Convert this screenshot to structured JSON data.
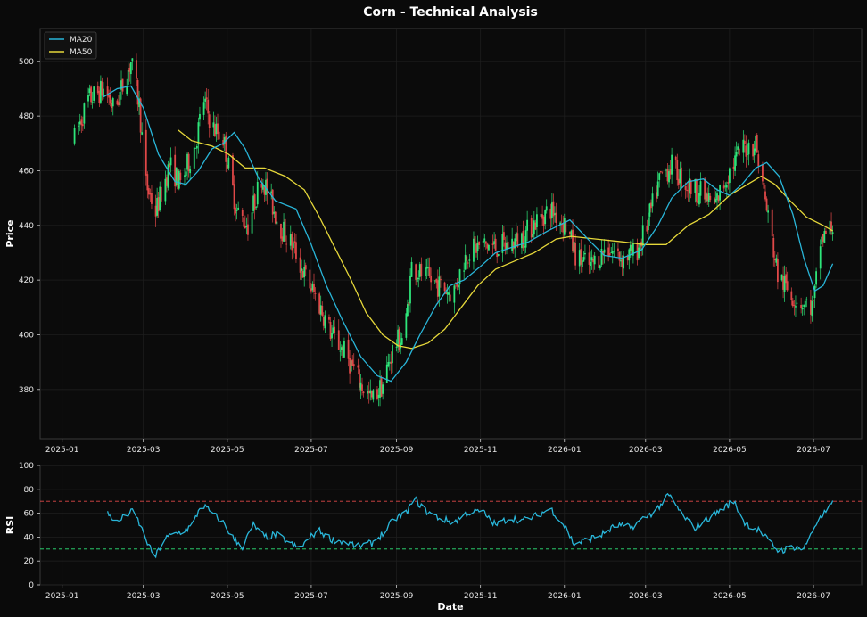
{
  "chart_data": [
    {
      "type": "candlestick",
      "title": "Corn - Technical Analysis",
      "ylabel": "Price",
      "ylim": [
        362,
        512
      ],
      "yticks": [
        380,
        400,
        420,
        440,
        460,
        480,
        500
      ],
      "xlim": [
        "2024-12-16",
        "2026-08-05"
      ],
      "xticks": [
        "2025-01",
        "2025-03",
        "2025-05",
        "2025-07",
        "2025-09",
        "2025-11",
        "2026-01",
        "2026-03",
        "2026-05",
        "2026-07"
      ],
      "grid": true,
      "legend": {
        "position": "top-left",
        "entries": [
          {
            "name": "MA20",
            "color": "#29b6d9"
          },
          {
            "name": "MA50",
            "color": "#e6d83a"
          }
        ]
      },
      "colors": {
        "up": "#2ee67a",
        "down": "#e04848"
      },
      "price_anchors": [
        [
          "2025-01-10",
          472
        ],
        [
          "2025-01-20",
          486
        ],
        [
          "2025-02-01",
          490
        ],
        [
          "2025-02-08",
          482
        ],
        [
          "2025-02-20",
          500
        ],
        [
          "2025-02-26",
          484
        ],
        [
          "2025-03-03",
          455
        ],
        [
          "2025-03-10",
          445
        ],
        [
          "2025-03-20",
          462
        ],
        [
          "2025-03-28",
          455
        ],
        [
          "2025-04-08",
          470
        ],
        [
          "2025-04-14",
          486
        ],
        [
          "2025-04-20",
          476
        ],
        [
          "2025-04-28",
          472
        ],
        [
          "2025-05-08",
          445
        ],
        [
          "2025-05-16",
          440
        ],
        [
          "2025-05-26",
          458
        ],
        [
          "2025-06-08",
          440
        ],
        [
          "2025-06-18",
          432
        ],
        [
          "2025-06-26",
          422
        ],
        [
          "2025-07-06",
          412
        ],
        [
          "2025-07-16",
          400
        ],
        [
          "2025-07-26",
          393
        ],
        [
          "2025-08-06",
          382
        ],
        [
          "2025-08-14",
          376
        ],
        [
          "2025-08-22",
          382
        ],
        [
          "2025-08-30",
          396
        ],
        [
          "2025-09-07",
          400
        ],
        [
          "2025-09-12",
          425
        ],
        [
          "2025-09-22",
          421
        ],
        [
          "2025-10-02",
          418
        ],
        [
          "2025-10-12",
          415
        ],
        [
          "2025-10-22",
          430
        ],
        [
          "2025-11-02",
          433
        ],
        [
          "2025-11-12",
          432
        ],
        [
          "2025-11-22",
          433
        ],
        [
          "2025-12-02",
          436
        ],
        [
          "2025-12-12",
          442
        ],
        [
          "2025-12-22",
          446
        ],
        [
          "2026-01-02",
          440
        ],
        [
          "2026-01-10",
          428
        ],
        [
          "2026-01-20",
          425
        ],
        [
          "2026-02-01",
          432
        ],
        [
          "2026-02-12",
          428
        ],
        [
          "2026-02-22",
          430
        ],
        [
          "2026-03-02",
          440
        ],
        [
          "2026-03-12",
          458
        ],
        [
          "2026-03-20",
          462
        ],
        [
          "2026-03-30",
          455
        ],
        [
          "2026-04-10",
          452
        ],
        [
          "2026-04-20",
          447
        ],
        [
          "2026-05-01",
          460
        ],
        [
          "2026-05-10",
          468
        ],
        [
          "2026-05-20",
          470
        ],
        [
          "2026-05-28",
          446
        ],
        [
          "2026-06-05",
          422
        ],
        [
          "2026-06-14",
          415
        ],
        [
          "2026-06-22",
          412
        ],
        [
          "2026-07-01",
          410
        ],
        [
          "2026-07-06",
          434
        ],
        [
          "2026-07-15",
          440
        ]
      ],
      "ma20": [
        [
          "2025-01-31",
          487
        ],
        [
          "2025-02-10",
          490
        ],
        [
          "2025-02-20",
          491
        ],
        [
          "2025-03-01",
          483
        ],
        [
          "2025-03-12",
          466
        ],
        [
          "2025-03-24",
          456
        ],
        [
          "2025-04-01",
          455
        ],
        [
          "2025-04-10",
          460
        ],
        [
          "2025-04-20",
          468
        ],
        [
          "2025-04-28",
          470
        ],
        [
          "2025-05-06",
          474
        ],
        [
          "2025-05-14",
          468
        ],
        [
          "2025-05-24",
          457
        ],
        [
          "2025-06-05",
          449
        ],
        [
          "2025-06-20",
          446
        ],
        [
          "2025-07-01",
          433
        ],
        [
          "2025-07-12",
          418
        ],
        [
          "2025-07-24",
          405
        ],
        [
          "2025-08-06",
          392
        ],
        [
          "2025-08-18",
          385
        ],
        [
          "2025-08-28",
          383
        ],
        [
          "2025-09-08",
          390
        ],
        [
          "2025-09-18",
          400
        ],
        [
          "2025-09-30",
          411
        ],
        [
          "2025-10-10",
          418
        ],
        [
          "2025-10-20",
          420
        ],
        [
          "2025-11-01",
          425
        ],
        [
          "2025-11-12",
          430
        ],
        [
          "2025-11-24",
          432
        ],
        [
          "2025-12-06",
          434
        ],
        [
          "2025-12-20",
          438
        ],
        [
          "2026-01-05",
          442
        ],
        [
          "2026-01-18",
          435
        ],
        [
          "2026-01-30",
          429
        ],
        [
          "2026-02-12",
          428
        ],
        [
          "2026-02-26",
          431
        ],
        [
          "2026-03-10",
          440
        ],
        [
          "2026-03-20",
          450
        ],
        [
          "2026-04-01",
          456
        ],
        [
          "2026-04-12",
          457
        ],
        [
          "2026-04-22",
          453
        ],
        [
          "2026-05-01",
          451
        ],
        [
          "2026-05-10",
          455
        ],
        [
          "2026-05-20",
          461
        ],
        [
          "2026-05-28",
          463
        ],
        [
          "2026-06-06",
          458
        ],
        [
          "2026-06-16",
          444
        ],
        [
          "2026-06-24",
          428
        ],
        [
          "2026-07-02",
          416
        ],
        [
          "2026-07-08",
          418
        ],
        [
          "2026-07-15",
          426
        ]
      ],
      "ma50": [
        [
          "2025-03-26",
          475
        ],
        [
          "2025-04-05",
          471
        ],
        [
          "2025-04-20",
          469
        ],
        [
          "2025-05-02",
          466
        ],
        [
          "2025-05-14",
          461
        ],
        [
          "2025-05-28",
          461
        ],
        [
          "2025-06-12",
          458
        ],
        [
          "2025-06-26",
          453
        ],
        [
          "2025-07-06",
          444
        ],
        [
          "2025-07-18",
          432
        ],
        [
          "2025-07-30",
          420
        ],
        [
          "2025-08-10",
          408
        ],
        [
          "2025-08-22",
          400
        ],
        [
          "2025-09-02",
          396
        ],
        [
          "2025-09-12",
          395
        ],
        [
          "2025-09-24",
          397
        ],
        [
          "2025-10-06",
          402
        ],
        [
          "2025-10-18",
          410
        ],
        [
          "2025-10-30",
          418
        ],
        [
          "2025-11-12",
          424
        ],
        [
          "2025-11-26",
          427
        ],
        [
          "2025-12-10",
          430
        ],
        [
          "2025-12-26",
          435
        ],
        [
          "2026-01-06",
          436
        ],
        [
          "2026-01-24",
          435
        ],
        [
          "2026-02-12",
          434
        ],
        [
          "2026-02-28",
          433
        ],
        [
          "2026-03-16",
          433
        ],
        [
          "2026-04-01",
          440
        ],
        [
          "2026-04-16",
          444
        ],
        [
          "2026-05-01",
          451
        ],
        [
          "2026-05-14",
          455
        ],
        [
          "2026-05-24",
          458
        ],
        [
          "2026-06-03",
          455
        ],
        [
          "2026-06-14",
          449
        ],
        [
          "2026-06-26",
          443
        ],
        [
          "2026-07-08",
          440
        ],
        [
          "2026-07-15",
          438
        ]
      ]
    },
    {
      "type": "line",
      "xlabel": "Date",
      "ylabel": "RSI",
      "ylim": [
        0,
        100
      ],
      "yticks": [
        0,
        20,
        40,
        60,
        80,
        100
      ],
      "reference_lines": [
        {
          "value": 70,
          "color": "#e04848"
        },
        {
          "value": 30,
          "color": "#2ee67a"
        }
      ],
      "series": [
        {
          "color": "#29b6d9",
          "values": [
            [
              "2025-02-03",
              60
            ],
            [
              "2025-02-10",
              52
            ],
            [
              "2025-02-16",
              58
            ],
            [
              "2025-02-22",
              62
            ],
            [
              "2025-02-28",
              46
            ],
            [
              "2025-03-06",
              30
            ],
            [
              "2025-03-10",
              24
            ],
            [
              "2025-03-16",
              38
            ],
            [
              "2025-03-22",
              42
            ],
            [
              "2025-03-30",
              45
            ],
            [
              "2025-04-06",
              50
            ],
            [
              "2025-04-12",
              68
            ],
            [
              "2025-04-20",
              60
            ],
            [
              "2025-04-28",
              52
            ],
            [
              "2025-05-06",
              38
            ],
            [
              "2025-05-12",
              32
            ],
            [
              "2025-05-20",
              50
            ],
            [
              "2025-05-28",
              40
            ],
            [
              "2025-06-06",
              42
            ],
            [
              "2025-06-14",
              36
            ],
            [
              "2025-06-22",
              30
            ],
            [
              "2025-06-28",
              37
            ],
            [
              "2025-07-06",
              46
            ],
            [
              "2025-07-16",
              38
            ],
            [
              "2025-07-26",
              36
            ],
            [
              "2025-08-04",
              32
            ],
            [
              "2025-08-14",
              35
            ],
            [
              "2025-08-24",
              45
            ],
            [
              "2025-08-30",
              55
            ],
            [
              "2025-09-08",
              60
            ],
            [
              "2025-09-14",
              72
            ],
            [
              "2025-09-22",
              62
            ],
            [
              "2025-10-02",
              56
            ],
            [
              "2025-10-12",
              52
            ],
            [
              "2025-10-22",
              60
            ],
            [
              "2025-11-02",
              62
            ],
            [
              "2025-11-12",
              50
            ],
            [
              "2025-11-22",
              56
            ],
            [
              "2025-12-02",
              54
            ],
            [
              "2025-12-12",
              58
            ],
            [
              "2025-12-22",
              64
            ],
            [
              "2026-01-02",
              48
            ],
            [
              "2026-01-08",
              34
            ],
            [
              "2026-01-18",
              38
            ],
            [
              "2026-01-28",
              42
            ],
            [
              "2026-02-08",
              50
            ],
            [
              "2026-02-18",
              48
            ],
            [
              "2026-02-28",
              56
            ],
            [
              "2026-03-08",
              62
            ],
            [
              "2026-03-18",
              75
            ],
            [
              "2026-03-28",
              58
            ],
            [
              "2026-04-06",
              48
            ],
            [
              "2026-04-16",
              56
            ],
            [
              "2026-04-26",
              64
            ],
            [
              "2026-05-04",
              70
            ],
            [
              "2026-05-12",
              52
            ],
            [
              "2026-05-22",
              46
            ],
            [
              "2026-05-30",
              36
            ],
            [
              "2026-06-06",
              28
            ],
            [
              "2026-06-16",
              32
            ],
            [
              "2026-06-24",
              30
            ],
            [
              "2026-07-02",
              50
            ],
            [
              "2026-07-08",
              58
            ],
            [
              "2026-07-15",
              68
            ]
          ]
        }
      ]
    }
  ]
}
